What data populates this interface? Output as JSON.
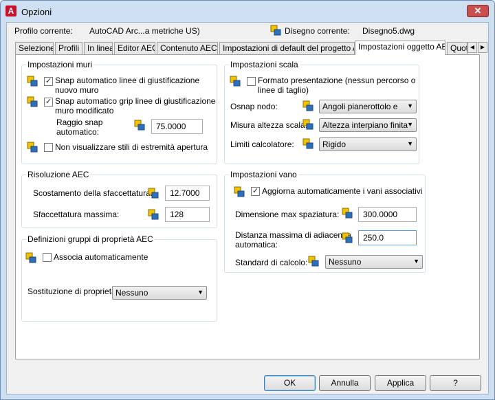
{
  "window": {
    "title": "Opzioni",
    "app_icon": "A",
    "close": "✕"
  },
  "header": {
    "profile_label": "Profilo corrente:",
    "profile_value": "AutoCAD Arc...a metriche US)",
    "drawing_label": "Disegno corrente:",
    "drawing_value": "Disegno5.dwg"
  },
  "tabs": [
    {
      "label": "Selezione"
    },
    {
      "label": "Profili"
    },
    {
      "label": "In linea"
    },
    {
      "label": "Editor AEC"
    },
    {
      "label": "Contenuto AEC"
    },
    {
      "label": "Impostazioni di default del progetto AEC"
    },
    {
      "label": "Impostazioni oggetto AEC",
      "active": true
    },
    {
      "label": "Quota"
    }
  ],
  "tab_scroll": {
    "left": "◀",
    "right": "▶"
  },
  "walls": {
    "title": "Impostazioni muri",
    "snap_auto_line1": "Snap automatico linee di giustificazione",
    "snap_auto_line2": "nuovo muro",
    "snap_auto_checked": true,
    "snap_grip_line1": "Snap automatico grip linee di giustificazione",
    "snap_grip_line2": "muro modificato",
    "snap_grip_checked": true,
    "radius_label_line1": "Raggio snap",
    "radius_label_line2": "automatico:",
    "radius_value": "75.0000",
    "no_styles_label": "Non visualizzare stili di estremità apertura",
    "no_styles_checked": false
  },
  "aec_resolution": {
    "title": "Risoluzione AEC",
    "offset_label": "Scostamento della sfaccettatura:",
    "offset_value": "12.7000",
    "max_label": "Sfaccettatura massima:",
    "max_value": "128"
  },
  "property_sets": {
    "title": "Definizioni gruppi di proprietà AEC",
    "auto_assoc_label": "Associa automaticamente",
    "auto_assoc_checked": false,
    "substitution_label": "Sostituzione di proprietà",
    "substitution_value": "Nessuno"
  },
  "scale": {
    "title": "Impostazioni scala",
    "presentation_line1": "Formato presentazione (nessun percorso o",
    "presentation_line2": "linee di taglio)",
    "presentation_checked": false,
    "osnap_label": "Osnap nodo:",
    "osnap_value": "Angoli pianerottolo e ram",
    "height_label": "Misura altezza scala:",
    "height_value": "Altezza interpiano finita",
    "limits_label": "Limiti calcolatore:",
    "limits_value": "Rigido"
  },
  "opening": {
    "title": "Impostazioni vano",
    "auto_update_label": "Aggiorna automaticamente i vani associativi",
    "auto_update_checked": true,
    "max_gap_label": "Dimensione max spaziatura:",
    "max_gap_value": "300.0000",
    "max_adj_line1": "Distanza massima di adiacenza",
    "max_adj_line2": "automatica:",
    "max_adj_value": "250.0",
    "calc_label": "Standard di calcolo:",
    "calc_value": "Nessuno"
  },
  "buttons": {
    "ok": "OK",
    "cancel": "Annulla",
    "apply": "Applica",
    "help": "?"
  },
  "colors": {
    "title_bg": "#cfe0f2",
    "close": "#c74f4f",
    "accent": "#3c7fb1"
  }
}
